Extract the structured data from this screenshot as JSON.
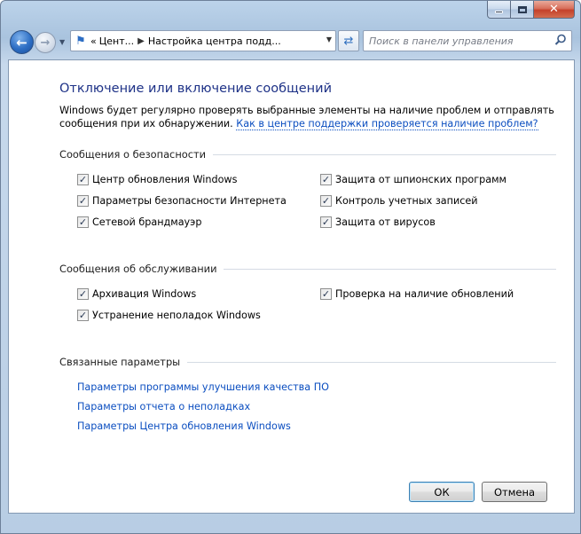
{
  "titlebar": {
    "minimize_icon": "minimize-icon",
    "maximize_icon": "maximize-icon",
    "close_glyph": "✕"
  },
  "nav": {
    "back_icon": "arrow-left-icon",
    "forward_icon": "arrow-right-icon",
    "breadcrumb": {
      "prefix": "«",
      "item1": "Цент...",
      "item2": "Настройка центра подд..."
    },
    "search_placeholder": "Поиск в панели управления"
  },
  "page": {
    "title": "Отключение или включение сообщений",
    "description": "Windows будет регулярно проверять выбранные элементы на наличие проблем и отправлять сообщения при их обнаружении.",
    "description_link": "Как в центре поддержки проверяется наличие проблем?"
  },
  "security": {
    "header": "Сообщения о безопасности",
    "left": [
      {
        "label": "Центр обновления Windows",
        "checked": true
      },
      {
        "label": "Параметры безопасности Интернета",
        "checked": true
      },
      {
        "label": "Сетевой брандмауэр",
        "checked": true
      }
    ],
    "right": [
      {
        "label": "Защита от шпионских программ",
        "checked": true
      },
      {
        "label": "Контроль учетных записей",
        "checked": true
      },
      {
        "label": "Защита от вирусов",
        "checked": true
      }
    ]
  },
  "maintenance": {
    "header": "Сообщения об обслуживании",
    "left": [
      {
        "label": "Архивация Windows",
        "checked": true
      },
      {
        "label": "Устранение неполадок Windows",
        "checked": true
      }
    ],
    "right": [
      {
        "label": "Проверка на наличие обновлений",
        "checked": true
      }
    ]
  },
  "related": {
    "header": "Связанные параметры",
    "links": [
      "Параметры программы улучшения качества ПО",
      "Параметры отчета о неполадках",
      "Параметры Центра обновления Windows"
    ]
  },
  "buttons": {
    "ok": "ОК",
    "cancel": "Отмена"
  },
  "check_glyph": "✓"
}
